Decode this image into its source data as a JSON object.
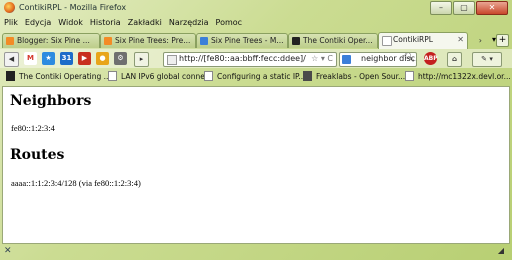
{
  "window": {
    "title": "ContikiRPL - Mozilla Firefox"
  },
  "menu": [
    "Plik",
    "Edycja",
    "Widok",
    "Historia",
    "Zakładki",
    "Narzędzia",
    "Pomoc"
  ],
  "tabs": [
    {
      "label": "Blogger: Six Pine ...",
      "icon_color": "#f38b26"
    },
    {
      "label": "Six Pine Trees: Pre...",
      "icon_color": "#f38b26"
    },
    {
      "label": "Six Pine Trees - M...",
      "icon_color": "#3b7fd9"
    },
    {
      "label": "The Contiki Oper...",
      "icon_color": "#222222"
    },
    {
      "label": "ContikiRPL",
      "icon_color": "#ffffff"
    }
  ],
  "address": {
    "url": "http://[fe80::aa:bbff:fecc:ddee]/"
  },
  "search": {
    "value": "neighbor disc..."
  },
  "bookmarks": [
    "The Contiki Operating ...",
    "LAN IPv6 global conne...",
    "Configuring a static IP...",
    "Freaklabs - Open Sour...",
    "http://mc1322x.devl.or..."
  ],
  "page": {
    "neighbors_heading": "Neighbors",
    "neighbor": "fe80::1:2:3:4",
    "routes_heading": "Routes",
    "route": "aaaa::1:1:2:3:4/128 (via fe80::1:2:3:4)"
  }
}
